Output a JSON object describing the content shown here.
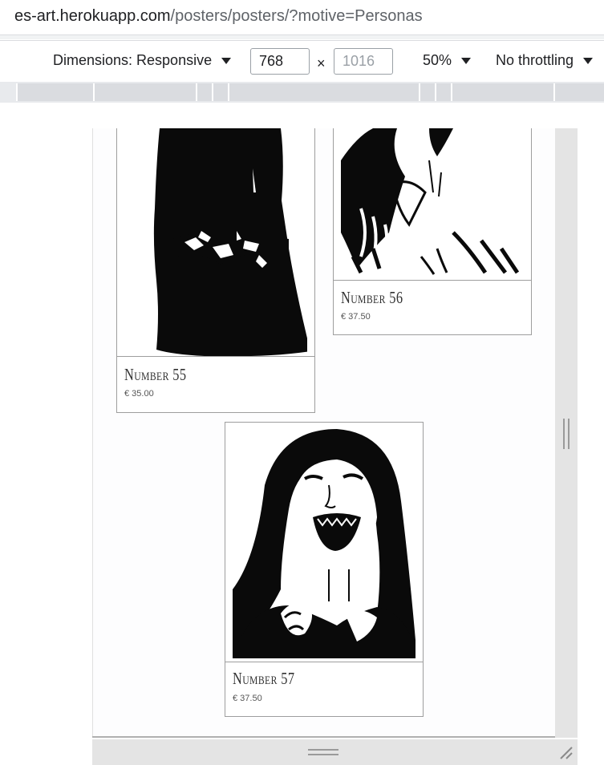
{
  "browser": {
    "url_host": "es-art.herokuapp.com",
    "url_path": "/posters/posters/?motive=Personas"
  },
  "device_toolbar": {
    "dimensions_label": "Dimensions: Responsive",
    "width": "768",
    "height_placeholder": "1016",
    "times": "×",
    "zoom": "50%",
    "throttling": "No throttling"
  },
  "products": [
    {
      "title": "Number 55",
      "price": "€ 35.00"
    },
    {
      "title": "Number 56",
      "price": "€ 37.50"
    },
    {
      "title": "Number 57",
      "price": "€ 37.50"
    }
  ],
  "icons": {
    "dropdown": "caret-down-icon",
    "resize_v": "vertical-resize-grip-icon",
    "resize_h": "horizontal-resize-grip-icon",
    "resize_corner": "corner-resize-icon"
  },
  "colors": {
    "toolbar_bg": "#ffffff",
    "ruler_bg": "#e8eaed",
    "scroll_bg": "#e4e4e4",
    "card_border": "#9e9e9e",
    "text": "#202124"
  }
}
